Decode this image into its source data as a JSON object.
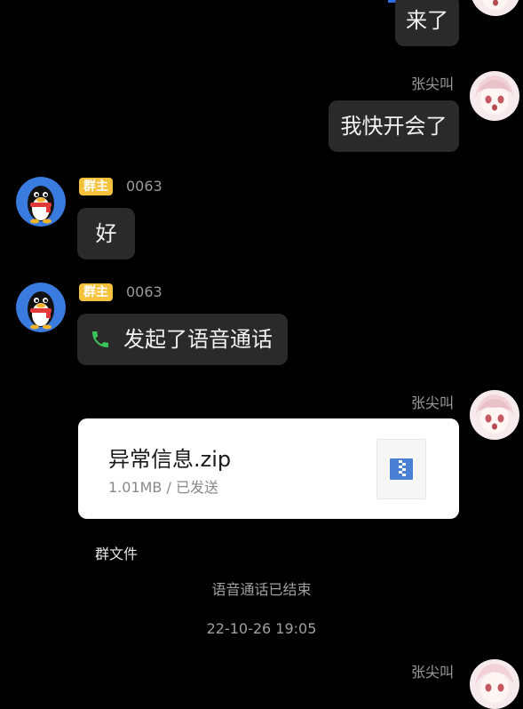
{
  "messages": {
    "m1_text": "来了",
    "m2_sender": "张尖叫",
    "m2_text": "我快开会了",
    "m3_badge": "群主",
    "m3_sender": "0063",
    "m3_text": "好",
    "m4_badge": "群主",
    "m4_sender": "0063",
    "m4_text": "发起了语音通话",
    "m5_sender": "张尖叫",
    "file": {
      "name": "异常信息.zip",
      "meta": "1.01MB / 已发送",
      "source": "群文件"
    },
    "system": {
      "call_ended": "语音通话已结束",
      "timestamp": "22-10-26 19:05"
    },
    "m6_sender": "张尖叫"
  },
  "colors": {
    "background": "#000000",
    "bubble": "#2a2a2a",
    "badge": "#f6c23b",
    "phone_icon": "#3cc25b",
    "file_icon": "#4a7fd6"
  },
  "icons": {
    "call": "phone-icon",
    "file": "zip-file-icon"
  }
}
